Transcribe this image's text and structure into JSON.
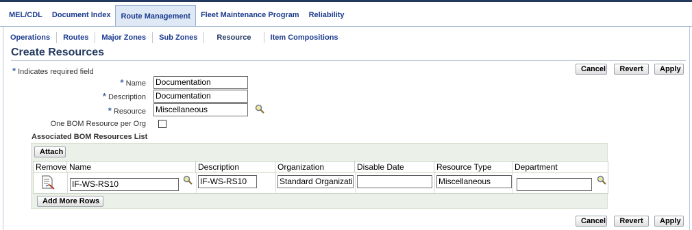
{
  "tabs": [
    {
      "label": "MEL/CDL",
      "active": false
    },
    {
      "label": "Document Index",
      "active": false
    },
    {
      "label": "Route Management",
      "active": true
    },
    {
      "label": "Fleet Maintenance Program",
      "active": false
    },
    {
      "label": "Reliability",
      "active": false
    }
  ],
  "subtabs": [
    {
      "label": "Operations",
      "active": false
    },
    {
      "label": "Routes",
      "active": false
    },
    {
      "label": "Major Zones",
      "active": false
    },
    {
      "label": "Sub Zones",
      "active": false
    },
    {
      "label": "Resource",
      "active": true
    },
    {
      "label": "Item Compositions",
      "active": false
    }
  ],
  "page": {
    "title": "Create Resources",
    "required_note": "Indicates required field",
    "required_star": "*"
  },
  "actions": {
    "cancel": "Cancel",
    "revert": "Revert",
    "apply": "Apply"
  },
  "form": {
    "name_label": "Name",
    "name_value": "Documentation",
    "description_label": "Description",
    "description_value": "Documentation",
    "resource_label": "Resource",
    "resource_value": "Miscellaneous",
    "one_bom_label": "One BOM Resource per Org",
    "one_bom_checked": false
  },
  "bom_list": {
    "title": "Associated BOM Resources List",
    "attach_label": "Attach",
    "add_rows_label": "Add More Rows",
    "columns": [
      "Remove",
      "Name",
      "Description",
      "Organization",
      "Disable Date",
      "Resource Type",
      "Department"
    ],
    "row": {
      "name": "IF-WS-RS10",
      "description": "IF-WS-RS10",
      "organization": "Standard Organizati",
      "disable_date": "",
      "resource_type": "Miscellaneous",
      "department": ""
    }
  },
  "icons": {
    "lookup": "magnifier-icon",
    "remove": "remove-document-icon"
  },
  "colors": {
    "tab_text": "#1b3b8e",
    "title": "#23395f",
    "required_star": "#436a9e",
    "table_band": "#ebf0e8"
  }
}
